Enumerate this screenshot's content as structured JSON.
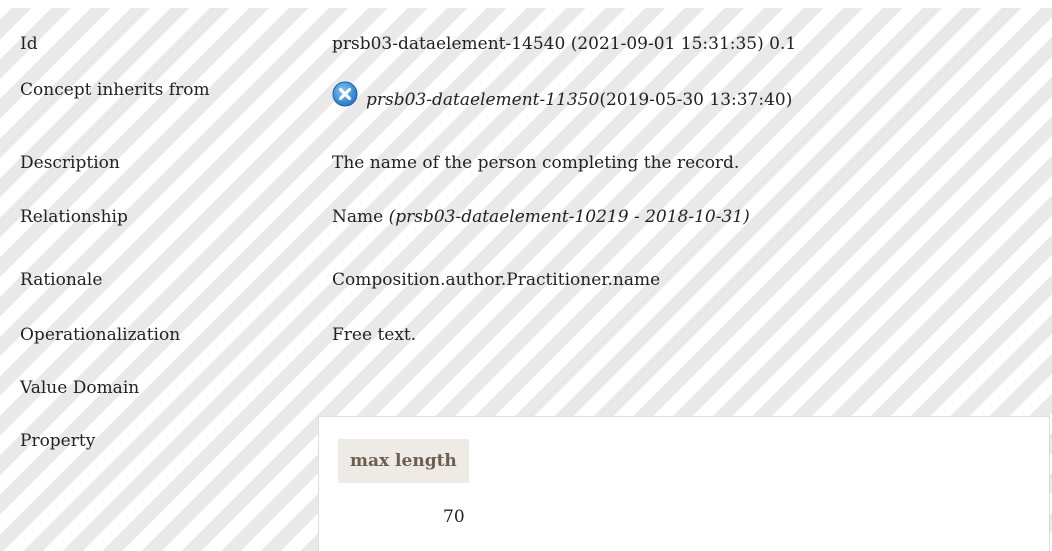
{
  "rows": {
    "id": {
      "label": "Id",
      "value": "prsb03-dataelement-14540 (2021-09-01 15:31:35) 0.1"
    },
    "concept_inherits": {
      "label": "Concept inherits from",
      "link": "prsb03-dataelement-11350",
      "suffix": " (2019-05-30 13:37:40)",
      "icon": "blue-x-circle-icon"
    },
    "description": {
      "label": "Description",
      "value": "The name of the person completing the record."
    },
    "relationship": {
      "label": "Relationship",
      "name": "Name ",
      "ref": "(prsb03-dataelement-10219 - 2018-10-31)"
    },
    "rationale": {
      "label": "Rationale",
      "value": "Composition.author.Practitioner.name"
    },
    "operationalization": {
      "label": "Operationalization",
      "value": "Free text."
    },
    "value_domain": {
      "label": "Value Domain"
    },
    "property": {
      "label": "Property",
      "header": "max length",
      "value": "70"
    }
  },
  "colors": {
    "stripe_light": "#ffffff",
    "stripe_dark": "#e9e9e9",
    "header_bg": "#eeeae6",
    "header_text": "#6f5e50",
    "icon_blue": "#2a88d8"
  }
}
